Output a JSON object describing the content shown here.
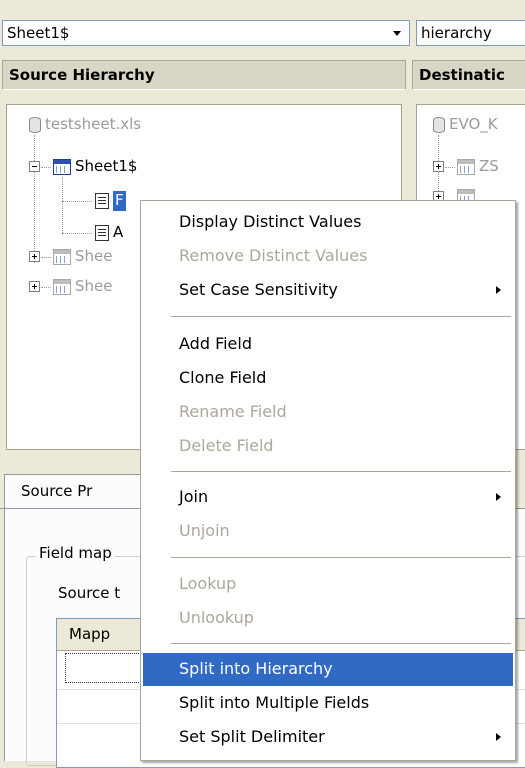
{
  "top_bar": {
    "left_combo_value": "Sheet1$",
    "right_combo_value": "hierarchy"
  },
  "source_panel": {
    "header": "Source Hierarchy",
    "tree": {
      "root": "testsheet.xls",
      "sheet": "Sheet1$",
      "field_1": "F",
      "field_2": "A",
      "sheet_2": "Shee",
      "sheet_3": "Shee"
    }
  },
  "destination_panel": {
    "header": "Destinatic",
    "tree": {
      "root": "EVO_K",
      "node_1": "ZS"
    }
  },
  "bottom": {
    "tab_source": "Source Pr",
    "group_title": "Field map",
    "source_label": "Source t",
    "grid_header": "Mapp"
  },
  "context_menu": {
    "items": [
      {
        "label": "Display Distinct Values",
        "enabled": true
      },
      {
        "label": "Remove Distinct Values",
        "enabled": false
      },
      {
        "label": "Set Case Sensitivity",
        "enabled": true,
        "submenu": true
      },
      {
        "label": "Add Field",
        "enabled": true
      },
      {
        "label": "Clone Field",
        "enabled": true
      },
      {
        "label": "Rename Field",
        "enabled": false
      },
      {
        "label": "Delete Field",
        "enabled": false
      },
      {
        "label": "Join",
        "enabled": true,
        "submenu": true
      },
      {
        "label": "Unjoin",
        "enabled": false
      },
      {
        "label": "Lookup",
        "enabled": false
      },
      {
        "label": "Unlookup",
        "enabled": false
      },
      {
        "label": "Split into Hierarchy",
        "enabled": true,
        "highlighted": true
      },
      {
        "label": "Split into Multiple Fields",
        "enabled": true
      },
      {
        "label": "Set Split Delimiter",
        "enabled": true,
        "submenu": true
      }
    ]
  },
  "colors": {
    "highlight": "#316ac5",
    "window_bg": "#ece9d8",
    "disabled_text": "#aca899"
  }
}
